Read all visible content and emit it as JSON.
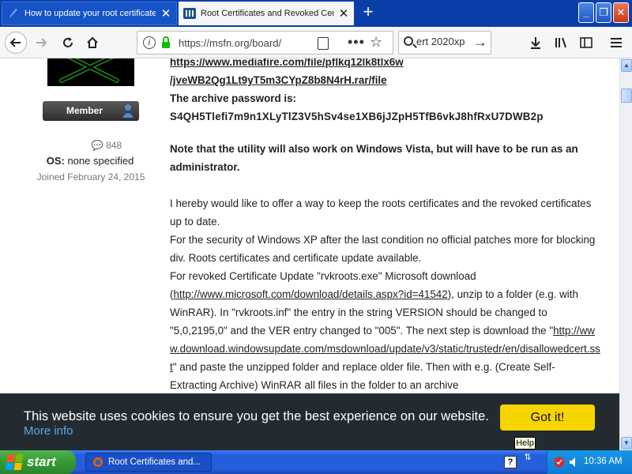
{
  "browser": {
    "tabs": [
      {
        "label": "How to update your root certificate",
        "active": false
      },
      {
        "label": "Root Certificates and Revoked Certificates",
        "active": true
      }
    ],
    "new_tab_label": "+",
    "window_controls": {
      "minimize": "_",
      "maximize": "❐",
      "close": "✕"
    },
    "url": "https://msfn.org/board/",
    "search_value": "ert 2020xp",
    "info_glyph": "i"
  },
  "author": {
    "rank": "Member",
    "posts": "848",
    "os_label": "OS:",
    "os_value": "none specified",
    "joined": "Joined February 24, 2015"
  },
  "post": {
    "link1_line1": "https://www.mediafire.com/file/pflkq12lk8tlx6w",
    "link1_line2": "/jveWB2Qg1Lt9yT5m3CYpZ8b8N4rH.rar/file",
    "password_label": "The archive password is:",
    "password": "S4QH5Tlefi7m9n1XLyTlZ3V5hSv4se1XB6jJZpH5TfB6vkJ8hfRxU7DWB2p",
    "vista_note": "Note that the utility will also work on Windows Vista, but will have to be run as an administrator.",
    "para1": "I hereby would like to offer a way to keep the roots certificates and the revoked certificates up to date.",
    "para2": "For the security of Windows XP after the last condition no official patches more for blocking div. Roots certificates and certificate update available.",
    "para3_a": "For revoked Certificate Update \"rvkroots.exe\" Microsoft download (",
    "para3_link": "http://www.microsoft.com/download/details.aspx?id=41542",
    "para3_b": "), unzip to a folder (e.g. with WinRAR). In \"rvkroots.inf\" the entry in the string VERSION should be changed to \"5,0,2195,0\" and the VER entry changed to \"005\". The next step is download the \"",
    "para3_link2": "http://www.download.windowsupdate.com/msdownload/update/v3/static/trustedr/en/disallowedcert.sst",
    "para3_c": "\" and paste the unzipped folder and replace older file. Then with e.g. (Create Self-Extracting Archive) WinRAR all files in the folder to an archive"
  },
  "cookie": {
    "message": "This website uses cookies to ensure you get the best experience on our website.",
    "more": "More info",
    "button": "Got it!"
  },
  "tooltip": "Help",
  "taskbar": {
    "start": "start",
    "item": "Root Certificates and...",
    "help_icon": "?",
    "clock": "10:36 AM"
  },
  "colors": {
    "tabstrip": "#0a3fa8",
    "cookie_bg": "#242b30",
    "cookie_button": "#f5d400",
    "more_info": "#5aa9e6",
    "taskbar": "#245edb",
    "start_button": "#349a34"
  }
}
